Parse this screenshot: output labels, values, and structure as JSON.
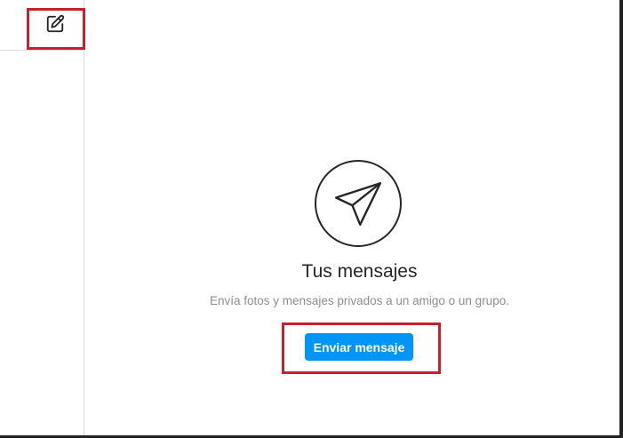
{
  "sidebar": {
    "compose_icon": "compose-edit-icon"
  },
  "empty_state": {
    "icon": "paper-plane-icon",
    "title": "Tus mensajes",
    "subtitle": "Envía fotos y mensajes privados a un amigo o un grupo.",
    "button_label": "Enviar mensaje"
  },
  "colors": {
    "accent": "#0095f6",
    "highlight": "#c8202f",
    "text_primary": "#262626",
    "text_secondary": "#8e8e8e",
    "divider": "#dbdbdb"
  }
}
